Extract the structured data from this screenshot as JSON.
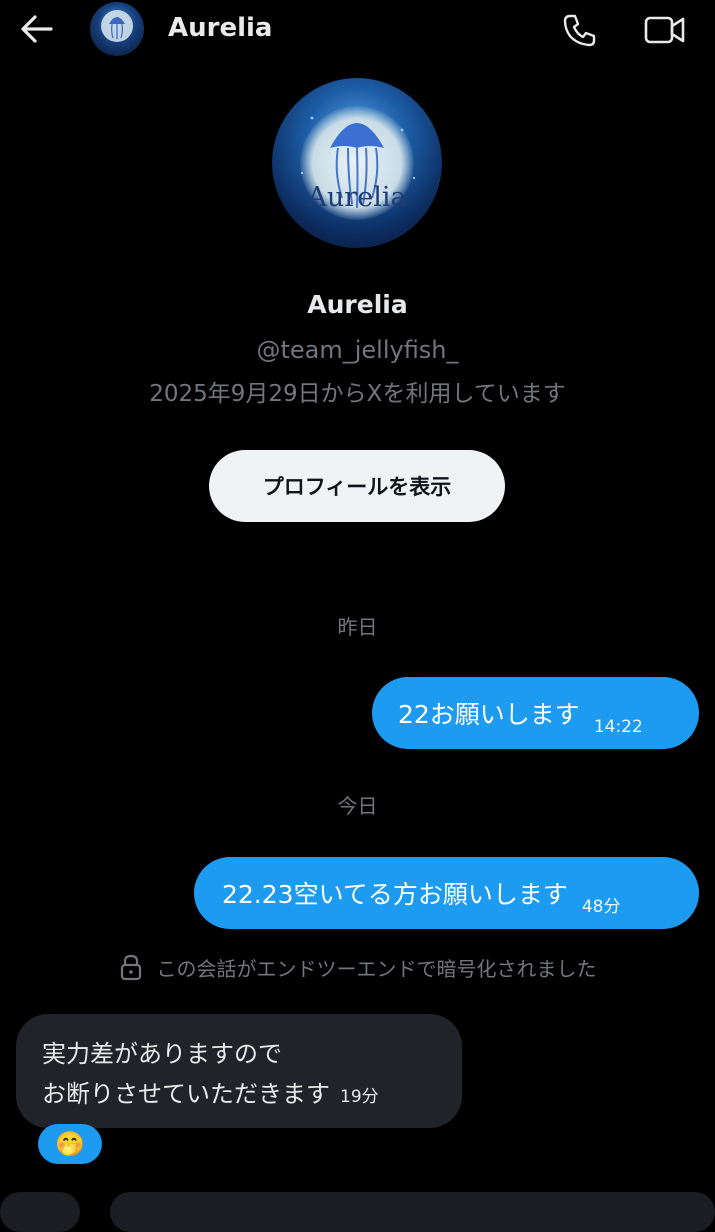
{
  "header": {
    "back_icon": "arrow-left-icon",
    "title": "Aurelia",
    "call_icon": "phone-icon",
    "video_icon": "video-camera-icon"
  },
  "profile": {
    "avatar_logo_text": "Aurelia",
    "name": "Aurelia",
    "handle": "@team_jellyfish_",
    "joined": "2025年9月29日からXを利用しています",
    "view_profile_label": "プロフィールを表示"
  },
  "conversation": {
    "date_yesterday": "昨日",
    "outgoing_1": {
      "text": "22お願いします",
      "time": "14:22"
    },
    "date_today": "今日",
    "outgoing_2": {
      "text": "22.23空いてる方お願いします",
      "time": "48分"
    },
    "encryption_notice": "この会話がエンドツーエンドで暗号化されました",
    "incoming_1": {
      "line1": "実力差がありますので",
      "line2": "お断りさせていただきます",
      "time": "19分"
    },
    "reaction": "🤭"
  },
  "colors": {
    "background": "#000000",
    "accent_blue": "#1d9bf0",
    "muted_text": "#71767b",
    "incoming_bubble": "#202327",
    "button_light": "#eff3f4"
  }
}
